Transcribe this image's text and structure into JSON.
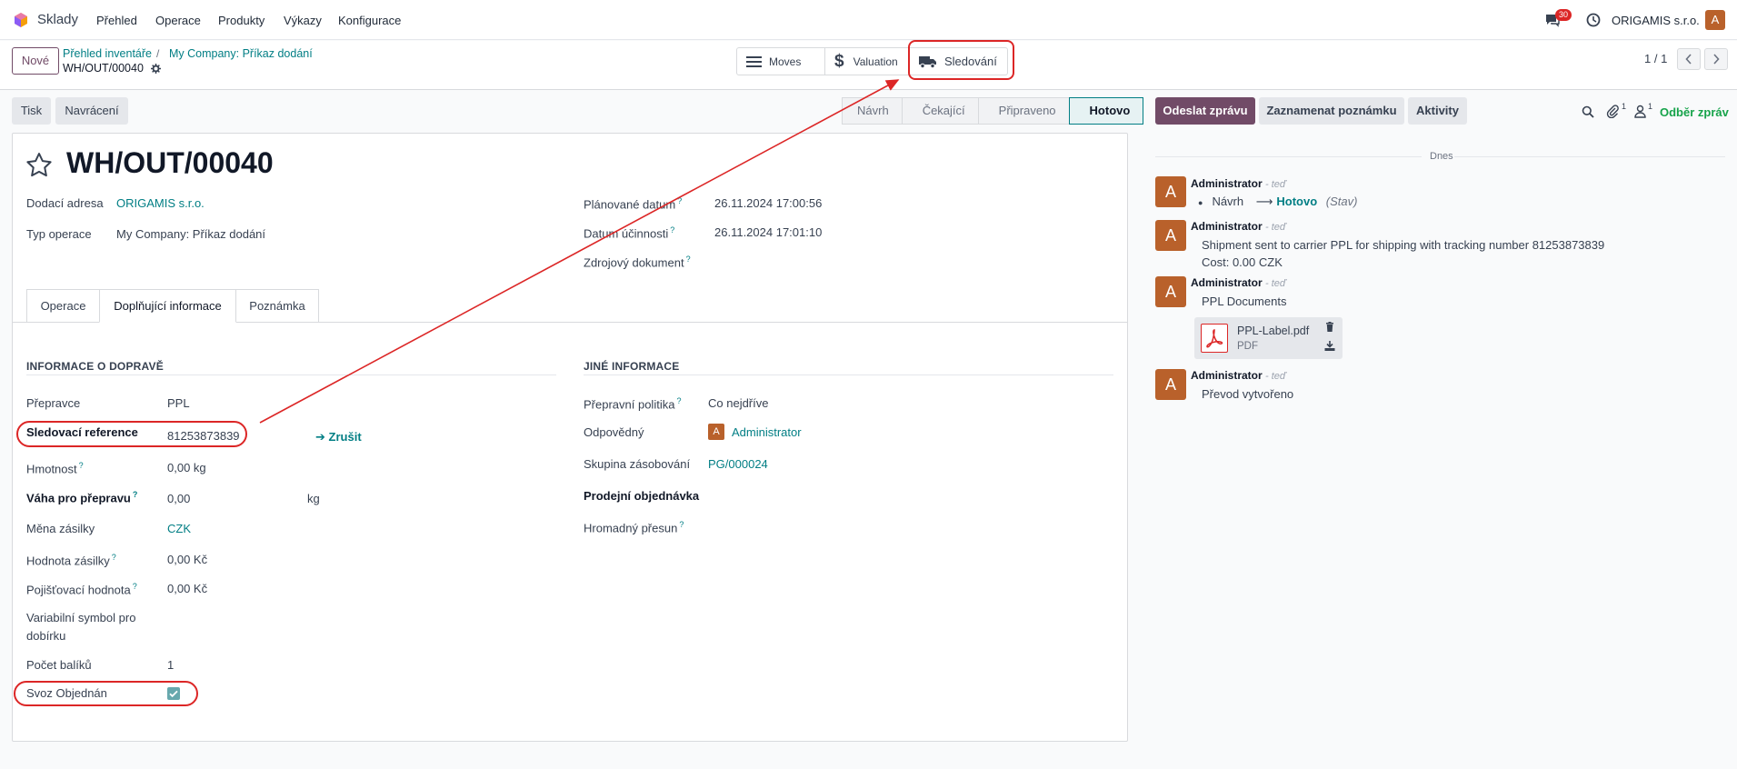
{
  "nav": {
    "app_name": "Sklady",
    "menu": [
      "Přehled",
      "Operace",
      "Produkty",
      "Výkazy",
      "Konfigurace"
    ],
    "chat_count": "30",
    "company": "ORIGAMIS s.r.o.",
    "user_initial": "A"
  },
  "control_panel": {
    "new_label": "Nové",
    "breadcrumb": [
      "Přehled inventáře",
      "My Company: Příkaz dodání"
    ],
    "record_name": "WH/OUT/00040",
    "smart_buttons": {
      "moves": "Moves",
      "valuation": "Valuation",
      "tracking": "Sledování"
    },
    "pager": "1 / 1"
  },
  "actions": {
    "print": "Tisk",
    "return": "Navrácení"
  },
  "statusbar": {
    "stages": [
      "Návrh",
      "Čekající",
      "Připraveno",
      "Hotovo"
    ],
    "active": "Hotovo"
  },
  "form": {
    "title": "WH/OUT/00040",
    "fields_left": {
      "delivery_address_label": "Dodací adresa",
      "delivery_address": "ORIGAMIS s.r.o.",
      "operation_type_label": "Typ operace",
      "operation_type": "My Company: Příkaz dodání"
    },
    "fields_right": {
      "scheduled_label": "Plánované datum",
      "scheduled": "26.11.2024 17:00:56",
      "effective_label": "Datum účinnosti",
      "effective": "26.11.2024 17:01:10",
      "source_label": "Zdrojový dokument"
    },
    "tabs": [
      "Operace",
      "Doplňující informace",
      "Poznámka"
    ],
    "shipping": {
      "section": "INFORMACE O DOPRAVĚ",
      "carrier_label": "Přepravce",
      "carrier": "PPL",
      "tracking_label": "Sledovací reference",
      "tracking": "81253873839",
      "cancel": "Zrušit",
      "weight_label": "Hmotnost",
      "weight": "0,00 kg",
      "ship_weight_label": "Váha pro přepravu",
      "ship_weight": "0,00",
      "ship_weight_unit": "kg",
      "currency_label": "Měna zásilky",
      "currency": "CZK",
      "value_label": "Hodnota zásilky",
      "value": "0,00 Kč",
      "insurance_label": "Pojišťovací hodnota",
      "insurance": "0,00 Kč",
      "var_symbol_label_1": "Variabilní symbol pro",
      "var_symbol_label_2": "dobírku",
      "packages_label": "Počet balíků",
      "packages": "1",
      "pickup_label": "Svoz Objednán",
      "pickup_checked": true
    },
    "other": {
      "section": "JINÉ INFORMACE",
      "policy_label": "Přepravní politika",
      "policy": "Co nejdříve",
      "responsible_label": "Odpovědný",
      "responsible": "Administrator",
      "group_label": "Skupina zásobování",
      "group": "PG/000024",
      "sale_label": "Prodejní objednávka",
      "batch_label": "Hromadný přesun"
    }
  },
  "chatter": {
    "send_message": "Odeslat zprávu",
    "log_note": "Zaznamenat poznámku",
    "activities": "Aktivity",
    "attachments_count": "1",
    "followers_count": "1",
    "follow": "Odběr zpráv",
    "date_separator": "Dnes",
    "messages": [
      {
        "author": "Administrator",
        "time": "- teď",
        "from": "Návrh",
        "to": "Hotovo",
        "field": "(Stav)"
      },
      {
        "author": "Administrator",
        "time": "- teď",
        "line1": "Shipment sent to carrier PPL for shipping with tracking number 81253873839",
        "line2": "Cost: 0.00 CZK"
      },
      {
        "author": "Administrator",
        "time": "- teď",
        "line1": "PPL Documents",
        "attachment_name": "PPL-Label.pdf",
        "attachment_type": "PDF"
      },
      {
        "author": "Administrator",
        "time": "- teď",
        "line1": "Převod vytvořeno"
      }
    ]
  },
  "colors": {
    "primary": "#714b67",
    "link": "#017e84",
    "annotation": "#dc2626",
    "avatar": "#b9612b"
  }
}
